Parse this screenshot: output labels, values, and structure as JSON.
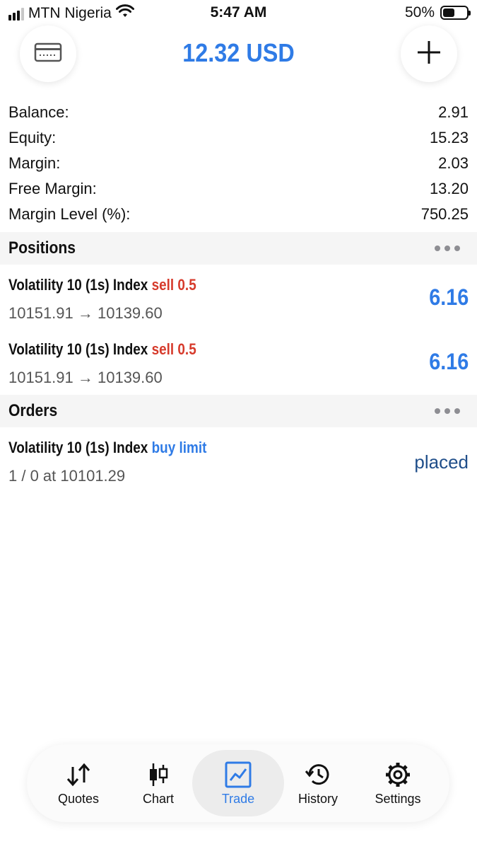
{
  "status_bar": {
    "carrier": "MTN Nigeria",
    "time": "5:47 AM",
    "battery": "50%",
    "battery_level": 0.5
  },
  "header": {
    "title": "12.32 USD",
    "left_icon": "card-icon",
    "right_icon": "plus-icon"
  },
  "summary": [
    {
      "label": "Balance:",
      "value": "2.91"
    },
    {
      "label": "Equity:",
      "value": "15.23"
    },
    {
      "label": "Margin:",
      "value": "2.03"
    },
    {
      "label": "Free Margin:",
      "value": "13.20"
    },
    {
      "label": "Margin Level (%):",
      "value": "750.25"
    }
  ],
  "positions": {
    "title": "Positions",
    "items": [
      {
        "symbol": "Volatility 10 (1s) Index",
        "side": "sell 0.5",
        "prices": "10151.91 → 10139.60",
        "profit": "6.16"
      },
      {
        "symbol": "Volatility 10 (1s) Index",
        "side": "sell 0.5",
        "prices": "10151.91 → 10139.60",
        "profit": "6.16"
      }
    ]
  },
  "orders": {
    "title": "Orders",
    "items": [
      {
        "symbol": "Volatility 10 (1s) Index",
        "side": "buy limit",
        "details": "1 / 0 at 10101.29",
        "status": "placed"
      }
    ]
  },
  "tabbar": {
    "tabs": [
      {
        "label": "Quotes",
        "icon": "arrows-updown-icon"
      },
      {
        "label": "Chart",
        "icon": "candlestick-icon"
      },
      {
        "label": "Trade",
        "icon": "trade-chart-icon",
        "active": true
      },
      {
        "label": "History",
        "icon": "history-icon"
      },
      {
        "label": "Settings",
        "icon": "gear-icon"
      }
    ]
  },
  "colors": {
    "accent": "#2f7be6",
    "sell": "#d63a2b",
    "section_bg": "#f5f5f5"
  }
}
